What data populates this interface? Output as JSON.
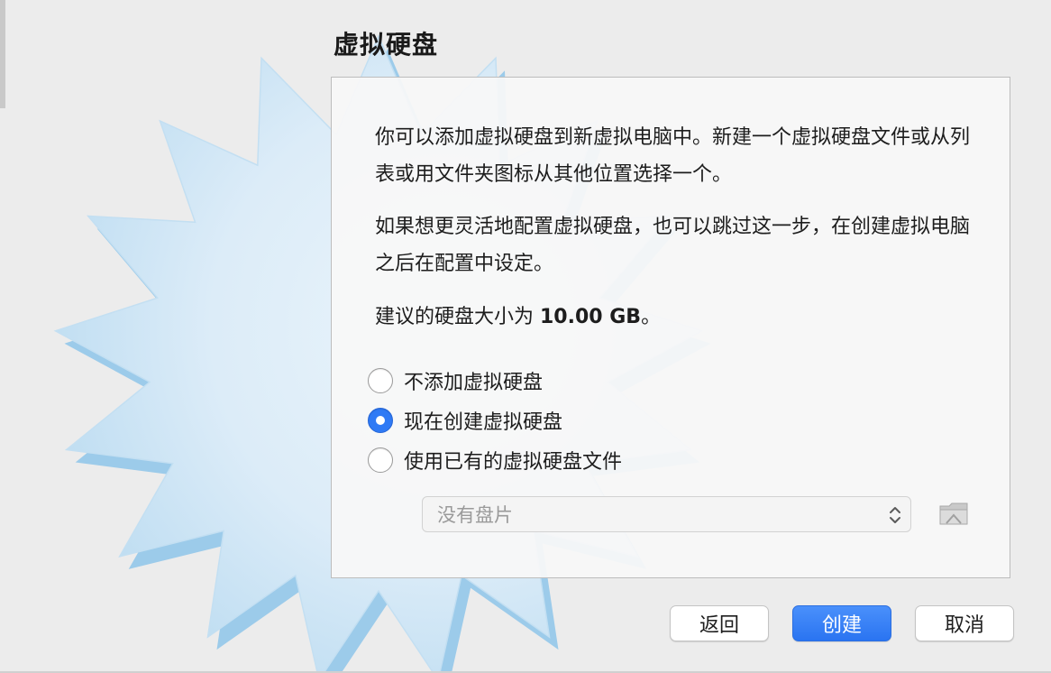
{
  "dialog": {
    "title": "虚拟硬盘",
    "paragraph1": "你可以添加虚拟硬盘到新虚拟电脑中。新建一个虚拟硬盘文件或从列表或用文件夹图标从其他位置选择一个。",
    "paragraph2": "如果想更灵活地配置虚拟硬盘，也可以跳过这一步，在创建虚拟电脑之后在配置中设定。",
    "recommend_prefix": "建议的硬盘大小为 ",
    "recommend_size": "10.00 GB",
    "recommend_suffix": "。"
  },
  "options": [
    {
      "label": "不添加虚拟硬盘",
      "selected": false
    },
    {
      "label": "现在创建虚拟硬盘",
      "selected": true
    },
    {
      "label": "使用已有的虚拟硬盘文件",
      "selected": false
    }
  ],
  "disk_select": {
    "value": "没有盘片"
  },
  "icons": {
    "folder": "folder-icon",
    "select_arrows": "chevron-up-down-icon",
    "background": "starburst-icon"
  },
  "buttons": {
    "back": "返回",
    "create": "创建",
    "cancel": "取消"
  },
  "colors": {
    "accent": "#2f7af5",
    "panel_bg": "#f8f8f8",
    "window_bg": "#ececec"
  }
}
